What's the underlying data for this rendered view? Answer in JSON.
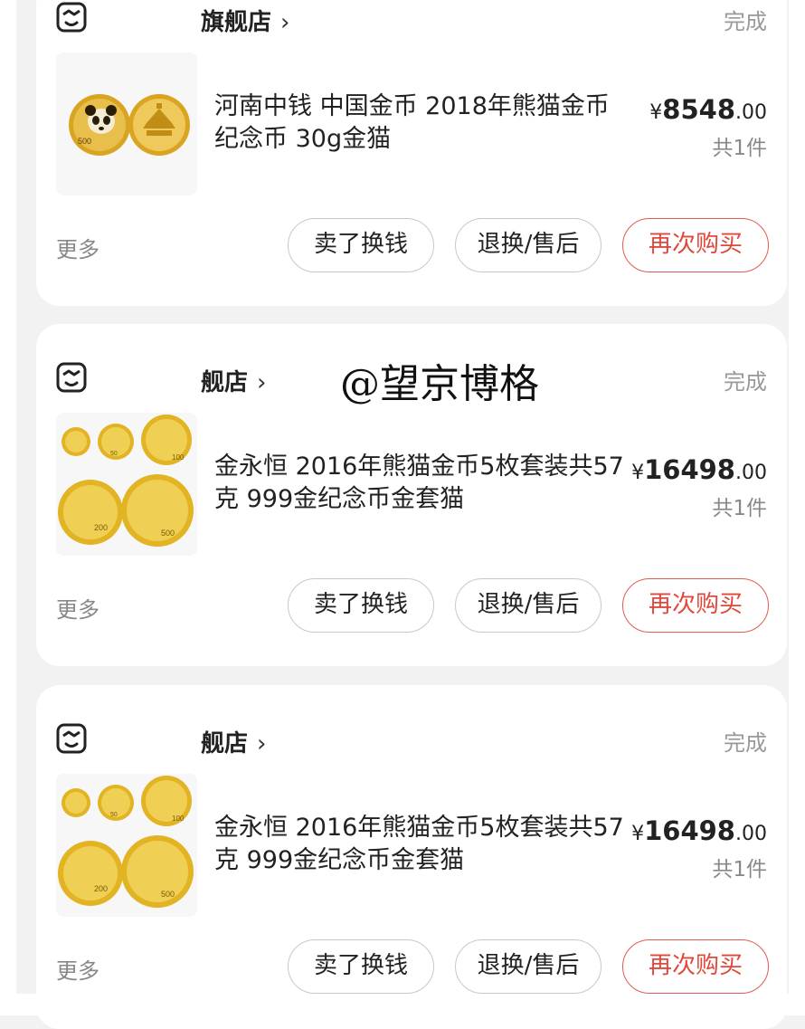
{
  "orders": [
    {
      "store_name": "旗舰店",
      "store_chevron": "›",
      "status": "完成",
      "title": "河南中钱 中国金币  2018年熊猫金币纪念币 30g金猫",
      "price_symbol": "¥",
      "price_integer": "8548",
      "price_decimal": ".00",
      "quantity": "共1件",
      "more": "更多",
      "buttons": [
        "卖了换钱",
        "退换/售后",
        "再次购买"
      ]
    },
    {
      "store_name": "舰店",
      "store_chevron": "›",
      "status": "完成",
      "title": "金永恒  2016年熊猫金币5枚套装共57克 999金纪念币金套猫",
      "price_symbol": "¥",
      "price_integer": "16498",
      "price_decimal": ".00",
      "quantity": "共1件",
      "more": "更多",
      "buttons": [
        "卖了换钱",
        "退换/售后",
        "再次购买"
      ]
    },
    {
      "store_name": "舰店",
      "store_chevron": "›",
      "status": "完成",
      "title": "金永恒  2016年熊猫金币5枚套装共57克 999金纪念币金套猫",
      "price_symbol": "¥",
      "price_integer": "16498",
      "price_decimal": ".00",
      "quantity": "共1件",
      "more": "更多",
      "buttons": [
        "卖了换钱",
        "退换/售后",
        "再次购买"
      ]
    }
  ],
  "coin_labels": {
    "single_face": "500",
    "set": [
      "50",
      "100",
      "200",
      "500"
    ]
  },
  "watermark": "@望京博格",
  "icons": {
    "store": "store-icon",
    "chevron": "chevron-right-icon"
  },
  "colors": {
    "accent_red": "#e0483c",
    "gold": "#e2b322"
  }
}
